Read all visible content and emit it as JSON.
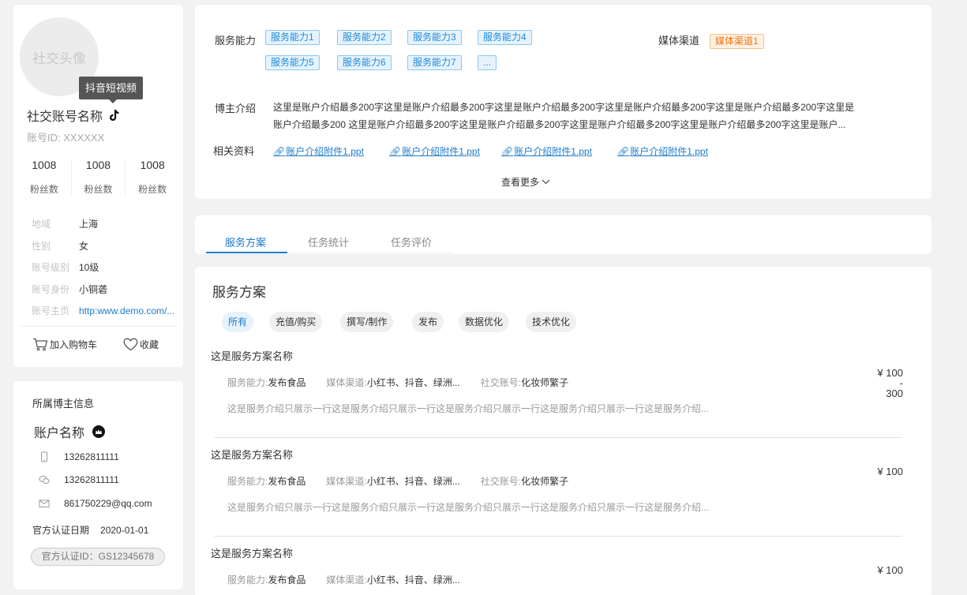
{
  "profile": {
    "avatar_text": "社交头像",
    "tooltip": "抖音短视频",
    "name": "社交账号名称",
    "account_id": "账号ID: XXXXXX",
    "fans": [
      {
        "num": "1008",
        "label": "粉丝数"
      },
      {
        "num": "1008",
        "label": "粉丝数"
      },
      {
        "num": "1008",
        "label": "粉丝数"
      }
    ],
    "info": [
      {
        "k": "地域",
        "v": "上海"
      },
      {
        "k": "性别",
        "v": "女"
      },
      {
        "k": "账号级别",
        "v": "10级"
      },
      {
        "k": "账号身份",
        "v": "小铜砻"
      },
      {
        "k": "账号主页",
        "v": "http:www.demo.com/..."
      }
    ],
    "add_cart": "加入购物车",
    "favorite": "收藏"
  },
  "owner": {
    "title": "所属博主信息",
    "name": "账户名称",
    "phone": "13262811111",
    "wechat": "13262811111",
    "email": "861750229@qq.com",
    "cert_date_label": "官方认证日期",
    "cert_date": "2020-01-01",
    "cert_id": "官方认证ID：GS12345678"
  },
  "detail": {
    "service_label": "服务能力",
    "services": [
      "服务能力1",
      "服务能力2",
      "服务能力3",
      "服务能力4",
      "服务能力5",
      "服务能力6",
      "服务能力7",
      "..."
    ],
    "channel_label": "媒体渠道",
    "channel": "媒体渠道1",
    "intro_label": "博主介绍",
    "intro_line1": "这里是账户介绍最多200字这里是账户介绍最多200字这里是账户介绍最多200字这里是账户介绍最多200字这里是账户介绍最多200字这里是",
    "intro_line2": "账户介绍最多200 这里是账户介绍最多200字这里是账户介绍最多200字这里是账户介绍最多200字这里是账户介绍最多200字这里是账户...",
    "attach_label": "相关资料",
    "attachments": [
      "账户介绍附件1.ppt",
      "账户介绍附件1.ppt",
      "账户介绍附件1.ppt",
      "账户介绍附件1.ppt"
    ],
    "more": "查看更多"
  },
  "tabs": [
    "服务方案",
    "任务统计",
    "任务评价"
  ],
  "plans": {
    "title": "服务方案",
    "filters": [
      "所有",
      "充值/购买",
      "撰写/制作",
      "发布",
      "数据优化",
      "技术优化"
    ],
    "items": [
      {
        "name": "这是服务方案名称",
        "ability_k": "服务能力:",
        "ability_v": "发布食品",
        "channel_k": "媒体渠道:",
        "channel_v": "小红书、抖音、绿洲...",
        "account_k": "社交账号:",
        "account_v": "化妆师繁子",
        "desc": "这是服务介绍只展示一行这是服务介绍只展示一行这是服务介绍只展示一行这是服务介绍只展示一行这是服务介绍...",
        "price": "¥ 100",
        "price_dash": "-",
        "price_max": "300"
      },
      {
        "name": "这是服务方案名称",
        "ability_k": "服务能力:",
        "ability_v": "发布食品",
        "channel_k": "媒体渠道:",
        "channel_v": "小红书、抖音、绿洲...",
        "account_k": "社交账号:",
        "account_v": "化妆师繁子",
        "desc": "这是服务介绍只展示一行这是服务介绍只展示一行这是服务介绍只展示一行这是服务介绍只展示一行这是服务介绍...",
        "price": "¥ 100"
      },
      {
        "name": "这是服务方案名称",
        "ability_k": "服务能力:",
        "ability_v": "发布食品",
        "channel_k": "媒体渠道:",
        "channel_v": "小红书、抖音、绿洲...",
        "price": "¥ 100"
      }
    ]
  },
  "colors": {
    "accent": "#1e7bc9",
    "tag_blue": "#1f8ad9",
    "tag_orange": "#e8741a"
  }
}
